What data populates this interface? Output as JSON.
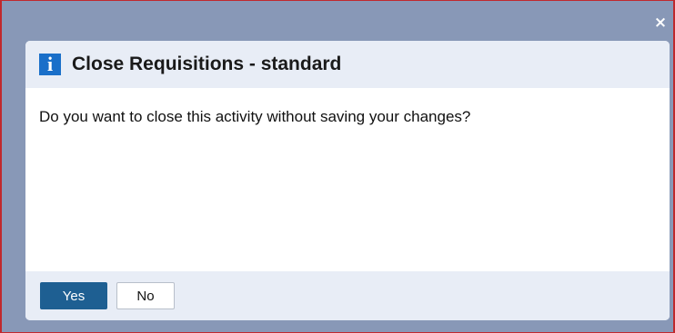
{
  "window": {
    "close_glyph": "×"
  },
  "dialog": {
    "icon": "info-icon",
    "icon_glyph": "i",
    "title": "Close Requisitions - standard",
    "message": "Do you want to close this activity without saving your changes?",
    "buttons": {
      "yes_label": "Yes",
      "no_label": "No"
    }
  },
  "colors": {
    "backdrop": "#8898b7",
    "frame_border": "#c0282d",
    "header_bg": "#e8edf6",
    "info_icon": "#1a6fc9",
    "primary_button": "#1e5f92"
  }
}
